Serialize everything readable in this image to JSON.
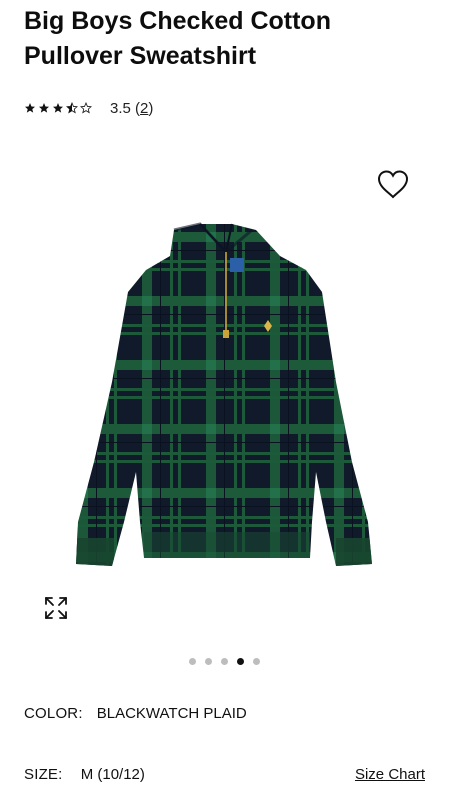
{
  "product": {
    "title": "Big Boys Checked Cotton Pullover Sweatshirt",
    "rating_value": "3.5",
    "rating_count": "2",
    "rating_stars": 3.5,
    "image_name": "blackwatch-plaid-quarter-zip-sweatshirt"
  },
  "gallery": {
    "dots": 5,
    "active_index": 3
  },
  "color": {
    "label": "COLOR:",
    "value": "BLACKWATCH PLAID"
  },
  "size": {
    "label": "SIZE:",
    "value": "M (10/12)",
    "chart_link": "Size Chart"
  },
  "icons": {
    "favorite": "heart-outline-icon",
    "expand": "expand-arrows-icon"
  },
  "colors": {
    "navy": "#101a2a",
    "green": "#1c5a3a",
    "text": "#111111"
  }
}
